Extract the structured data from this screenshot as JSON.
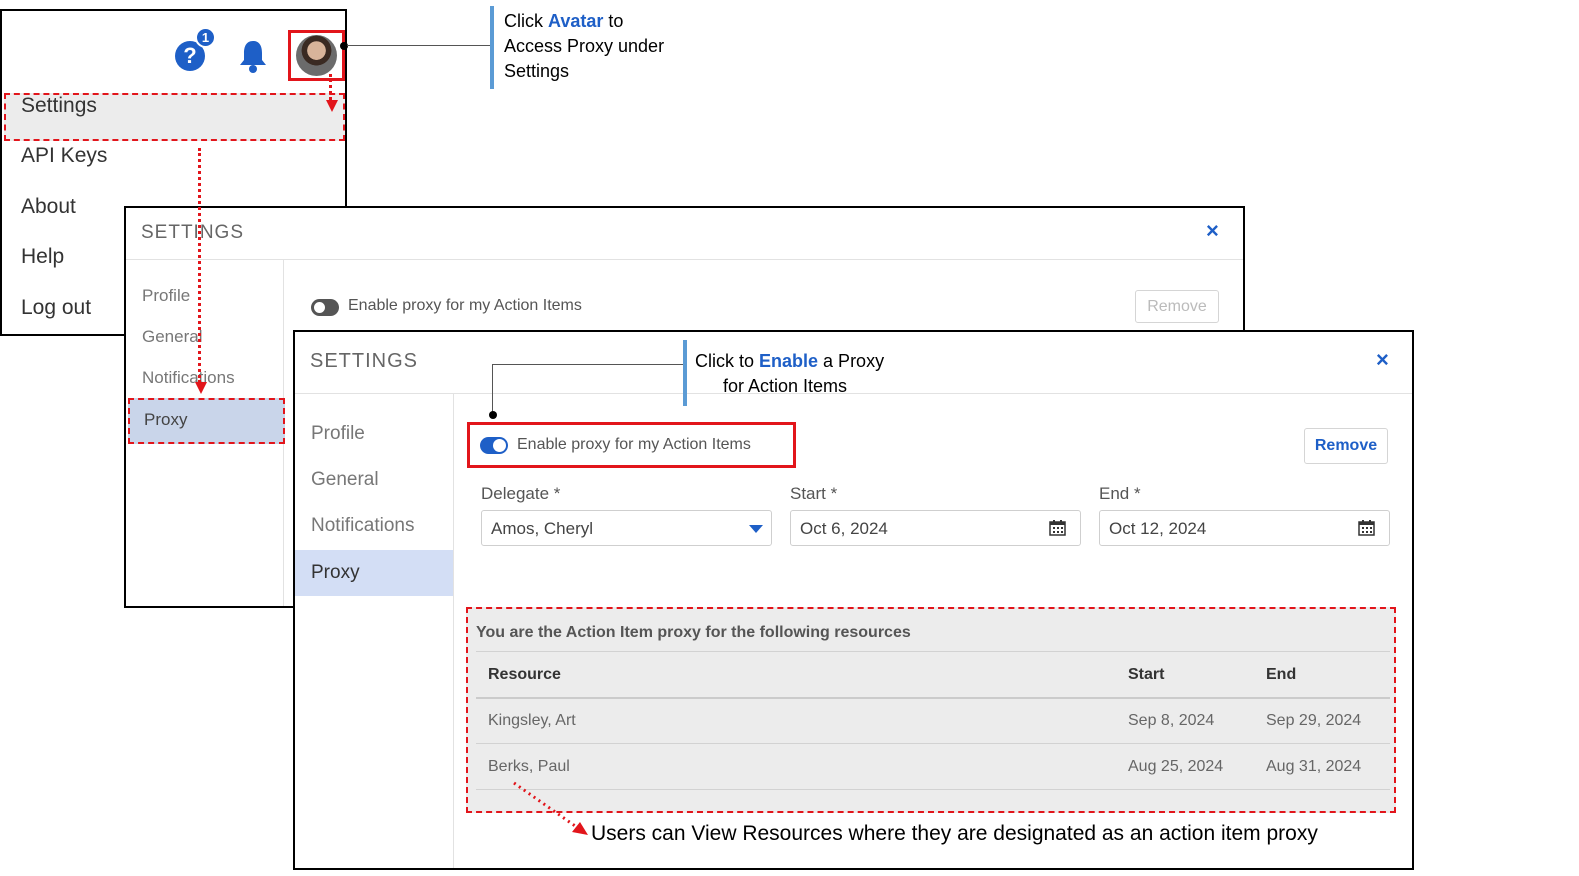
{
  "top_menu": {
    "help_badge": "1",
    "help_glyph": "?",
    "items": [
      "Settings",
      "API Keys",
      "About",
      "Help",
      "Log out"
    ]
  },
  "callout_avatar": {
    "prefix": "Click ",
    "em": "Avatar",
    "suffix": " to",
    "line2": "Access Proxy under",
    "line3": "Settings"
  },
  "callout_enable": {
    "prefix": "Click to ",
    "em": "Enable",
    "suffix": " a Proxy",
    "line2": "for Action Items"
  },
  "callout_users": "Users can View Resources where they are designated as an action item proxy",
  "settings_back": {
    "title": "SETTINGS",
    "close": "×",
    "nav": [
      "Profile",
      "General",
      "Notifications",
      "Proxy"
    ],
    "toggle_label": "Enable proxy for my Action Items",
    "toggle_on": false,
    "remove_label": "Remove"
  },
  "settings_front": {
    "title": "SETTINGS",
    "close": "×",
    "nav": [
      "Profile",
      "General",
      "Notifications",
      "Proxy"
    ],
    "selected_nav": "Proxy",
    "toggle_label": "Enable proxy for my Action Items",
    "toggle_on": true,
    "remove_label": "Remove",
    "fields": {
      "delegate": {
        "label": "Delegate",
        "required": "*",
        "value": "Amos, Cheryl"
      },
      "start": {
        "label": "Start",
        "required": "*",
        "value": "Oct 6, 2024"
      },
      "end": {
        "label": "End",
        "required": "*",
        "value": "Oct 12, 2024"
      }
    },
    "proxy_table": {
      "title": "You are the Action Item proxy for the following resources",
      "headers": [
        "Resource",
        "Start",
        "End"
      ],
      "rows": [
        [
          "Kingsley, Art",
          "Sep 8, 2024",
          "Sep 29, 2024"
        ],
        [
          "Berks, Paul",
          "Aug 25, 2024",
          "Aug 31, 2024"
        ]
      ]
    }
  },
  "colors": {
    "accent": "#1e5fc7",
    "highlight_red": "#e2151b",
    "callout_bar": "#5b9bd5",
    "selected_nav_bg": "#d3def5"
  }
}
